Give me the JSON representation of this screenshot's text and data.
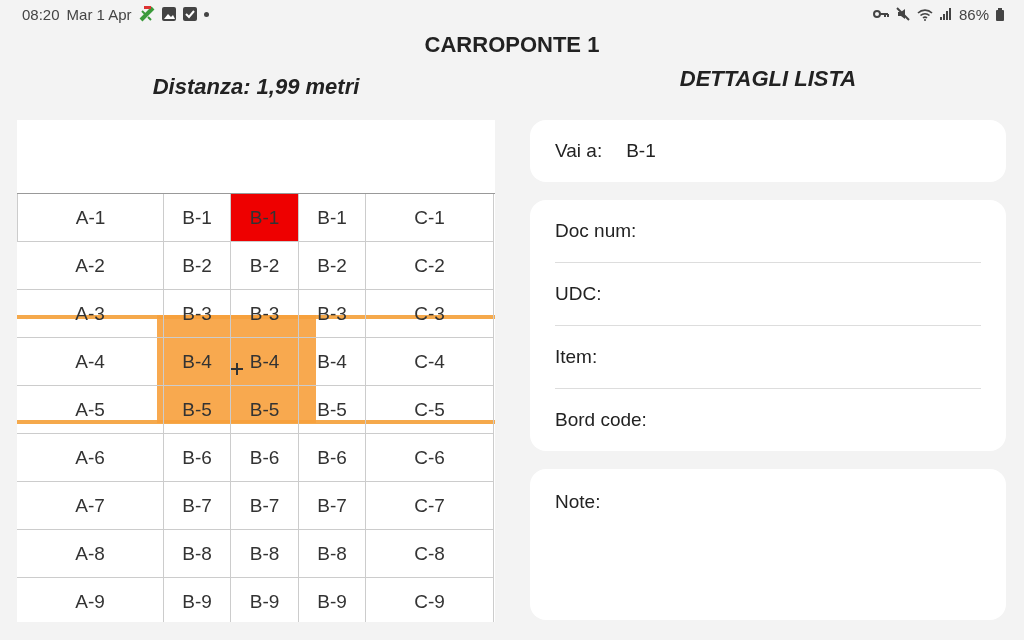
{
  "status_bar": {
    "time": "08:20",
    "date": "Mar 1 Apr",
    "battery": "86%"
  },
  "title": "CARROPONTE 1",
  "left": {
    "distance": "Distanza: 1,99 metri",
    "grid": [
      [
        {
          "text": "A-1",
          "highlighted": false
        },
        {
          "text": "B-1",
          "highlighted": false
        },
        {
          "text": "B-1",
          "highlighted": true
        },
        {
          "text": "B-1",
          "highlighted": false
        },
        {
          "text": "C-1",
          "highlighted": false
        }
      ],
      [
        {
          "text": "A-2",
          "highlighted": false
        },
        {
          "text": "B-2",
          "highlighted": false
        },
        {
          "text": "B-2",
          "highlighted": false
        },
        {
          "text": "B-2",
          "highlighted": false
        },
        {
          "text": "C-2",
          "highlighted": false
        }
      ],
      [
        {
          "text": "A-3",
          "highlighted": false
        },
        {
          "text": "B-3",
          "highlighted": false
        },
        {
          "text": "B-3",
          "highlighted": false
        },
        {
          "text": "B-3",
          "highlighted": false
        },
        {
          "text": "C-3",
          "highlighted": false
        }
      ],
      [
        {
          "text": "A-4",
          "highlighted": false
        },
        {
          "text": "B-4",
          "highlighted": false
        },
        {
          "text": "B-4",
          "highlighted": false
        },
        {
          "text": "B-4",
          "highlighted": false
        },
        {
          "text": "C-4",
          "highlighted": false
        }
      ],
      [
        {
          "text": "A-5",
          "highlighted": false
        },
        {
          "text": "B-5",
          "highlighted": false
        },
        {
          "text": "B-5",
          "highlighted": false
        },
        {
          "text": "B-5",
          "highlighted": false
        },
        {
          "text": "C-5",
          "highlighted": false
        }
      ],
      [
        {
          "text": "A-6",
          "highlighted": false
        },
        {
          "text": "B-6",
          "highlighted": false
        },
        {
          "text": "B-6",
          "highlighted": false
        },
        {
          "text": "B-6",
          "highlighted": false
        },
        {
          "text": "C-6",
          "highlighted": false
        }
      ],
      [
        {
          "text": "A-7",
          "highlighted": false
        },
        {
          "text": "B-7",
          "highlighted": false
        },
        {
          "text": "B-7",
          "highlighted": false
        },
        {
          "text": "B-7",
          "highlighted": false
        },
        {
          "text": "C-7",
          "highlighted": false
        }
      ],
      [
        {
          "text": "A-8",
          "highlighted": false
        },
        {
          "text": "B-8",
          "highlighted": false
        },
        {
          "text": "B-8",
          "highlighted": false
        },
        {
          "text": "B-8",
          "highlighted": false
        },
        {
          "text": "C-8",
          "highlighted": false
        }
      ],
      [
        {
          "text": "A-9",
          "highlighted": false
        },
        {
          "text": "B-9",
          "highlighted": false
        },
        {
          "text": "B-9",
          "highlighted": false
        },
        {
          "text": "B-9",
          "highlighted": false
        },
        {
          "text": "C-9",
          "highlighted": false
        }
      ]
    ]
  },
  "right": {
    "heading": "DETTAGLI LISTA",
    "goto": {
      "label": "Vai a:",
      "value": "B-1"
    },
    "details": [
      {
        "label": "Doc num:"
      },
      {
        "label": "UDC:"
      },
      {
        "label": "Item:"
      },
      {
        "label": "Bord code:"
      }
    ],
    "note": {
      "label": "Note:"
    }
  }
}
